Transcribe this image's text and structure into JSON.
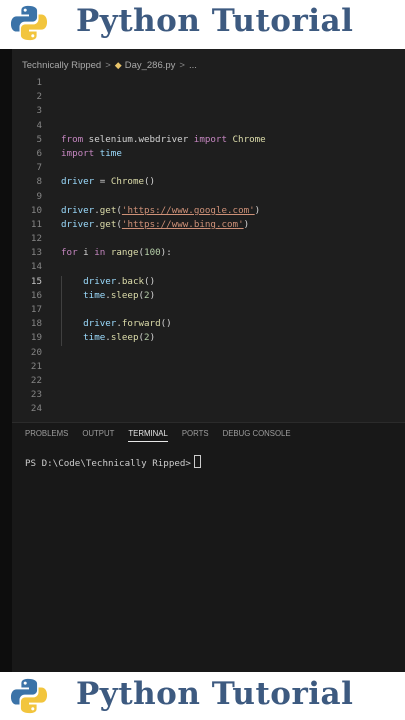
{
  "banner": {
    "title": "Python Tutorial"
  },
  "breadcrumb": {
    "folder": "Technically Ripped",
    "sep1": ">",
    "file": "Day_286.py",
    "sep2": ">",
    "tail": "..."
  },
  "code": {
    "lines": [
      {
        "n": "1"
      },
      {
        "n": "2"
      },
      {
        "n": "3"
      },
      {
        "n": "4"
      },
      {
        "n": "5",
        "p": [
          "from",
          " selenium.webdriver ",
          "import",
          " Chrome"
        ]
      },
      {
        "n": "6",
        "p": [
          "import",
          " time"
        ]
      },
      {
        "n": "7"
      },
      {
        "n": "8",
        "p": [
          "driver",
          " = ",
          "Chrome",
          "()"
        ]
      },
      {
        "n": "9"
      },
      {
        "n": "10",
        "p": [
          "driver",
          ".",
          "get",
          "(",
          "'https://www.google.com'",
          ")"
        ]
      },
      {
        "n": "11",
        "p": [
          "driver",
          ".",
          "get",
          "(",
          "'https://www.bing.com'",
          ")"
        ]
      },
      {
        "n": "12"
      },
      {
        "n": "13",
        "p": [
          "for",
          " i ",
          "in",
          " ",
          "range",
          "(",
          "100",
          "):"
        ]
      },
      {
        "n": "14"
      },
      {
        "n": "15",
        "p": [
          "    ",
          "driver",
          ".",
          "back",
          "()"
        ]
      },
      {
        "n": "16",
        "p": [
          "    ",
          "time",
          ".",
          "sleep",
          "(",
          "2",
          ")"
        ]
      },
      {
        "n": "17"
      },
      {
        "n": "18",
        "p": [
          "    ",
          "driver",
          ".",
          "forward",
          "()"
        ]
      },
      {
        "n": "19",
        "p": [
          "    ",
          "time",
          ".",
          "sleep",
          "(",
          "2",
          ")"
        ]
      },
      {
        "n": "20"
      },
      {
        "n": "21"
      },
      {
        "n": "22"
      },
      {
        "n": "23"
      },
      {
        "n": "24"
      }
    ]
  },
  "panel": {
    "tabs": [
      "PROBLEMS",
      "OUTPUT",
      "TERMINAL",
      "PORTS",
      "DEBUG CONSOLE"
    ],
    "active_tab": "TERMINAL",
    "terminal_prompt": "PS D:\\Code\\Technically Ripped>"
  },
  "colors": {
    "banner_text": "#3d5a80",
    "editor_bg": "#1e1e1e",
    "keyword": "#c586c0",
    "function": "#dcdcaa",
    "string": "#ce9178",
    "number": "#b5cea8",
    "variable": "#9cdcfe"
  }
}
